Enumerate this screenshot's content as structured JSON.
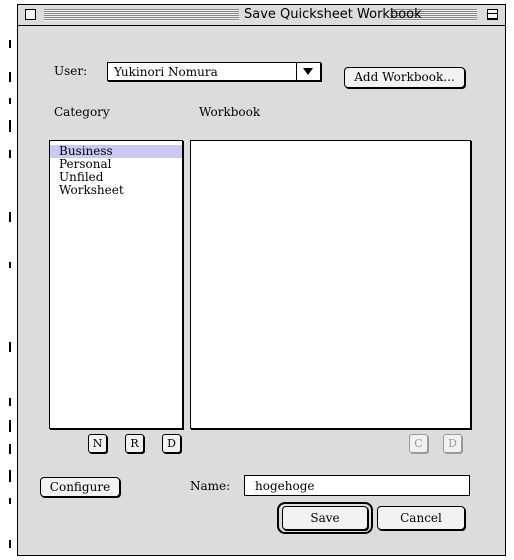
{
  "window": {
    "title": "Save Quicksheet Workbook"
  },
  "user": {
    "label": "User:",
    "selected": "Yukinori Nomura"
  },
  "buttons": {
    "add_workbook": "Add Workbook...",
    "configure": "Configure",
    "save": "Save",
    "cancel": "Cancel"
  },
  "columns": {
    "category": "Category",
    "workbook": "Workbook"
  },
  "categories": [
    {
      "label": "Business",
      "selected": true
    },
    {
      "label": "Personal",
      "selected": false
    },
    {
      "label": "Unfiled",
      "selected": false
    },
    {
      "label": "Worksheet",
      "selected": false
    }
  ],
  "category_buttons": [
    "N",
    "R",
    "D"
  ],
  "workbook_buttons": [
    "C",
    "D"
  ],
  "name": {
    "label": "Name:",
    "value": "hogehoge"
  },
  "colors": {
    "window_bg": "#dcdcdc",
    "selection": "#c9c9f3"
  },
  "icons": [
    "close-box-icon",
    "zoom-box-icon",
    "popup-arrow-icon"
  ]
}
